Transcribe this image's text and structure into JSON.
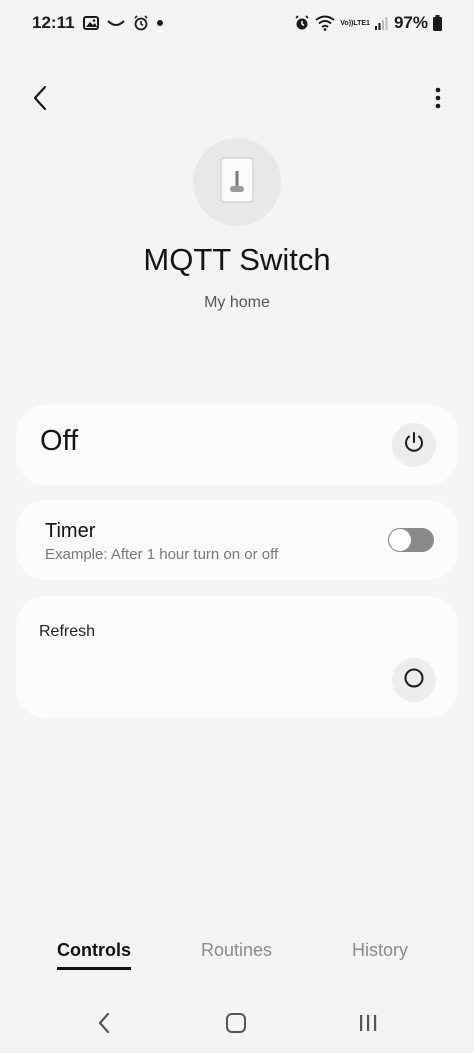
{
  "status_bar": {
    "time": "12:11",
    "volte_top": "Vo))",
    "volte_bottom": "LTE1",
    "battery_percent": "97%",
    "icons": [
      "image-icon",
      "wave-icon",
      "alarm-clock-icon",
      "notification-dot",
      "alarm-icon",
      "wifi-icon",
      "volte-icon",
      "signal-icon",
      "battery-icon"
    ]
  },
  "header": {
    "back_icon": "chevron-left-icon",
    "more_icon": "more-vertical-icon"
  },
  "device": {
    "icon": "switch-device-icon",
    "name": "MQTT Switch",
    "location": "My home"
  },
  "power_card": {
    "state_label": "Off",
    "icon": "power-icon"
  },
  "timer_card": {
    "title": "Timer",
    "description": "Example: After 1 hour turn on or off",
    "toggle_on": false
  },
  "refresh_card": {
    "title": "Refresh",
    "icon": "circle-icon"
  },
  "tabs": [
    {
      "label": "Controls",
      "active": true
    },
    {
      "label": "Routines",
      "active": false
    },
    {
      "label": "History",
      "active": false
    }
  ],
  "system_nav": {
    "back_icon": "nav-back-icon",
    "home_icon": "nav-home-icon",
    "recents_icon": "nav-recents-icon"
  },
  "colors": {
    "background": "#f4f4f4",
    "card": "#fbfbfb",
    "accent_text": "#141414",
    "muted_text": "#8a8a8a",
    "toggle_track": "#8a8a8a"
  }
}
